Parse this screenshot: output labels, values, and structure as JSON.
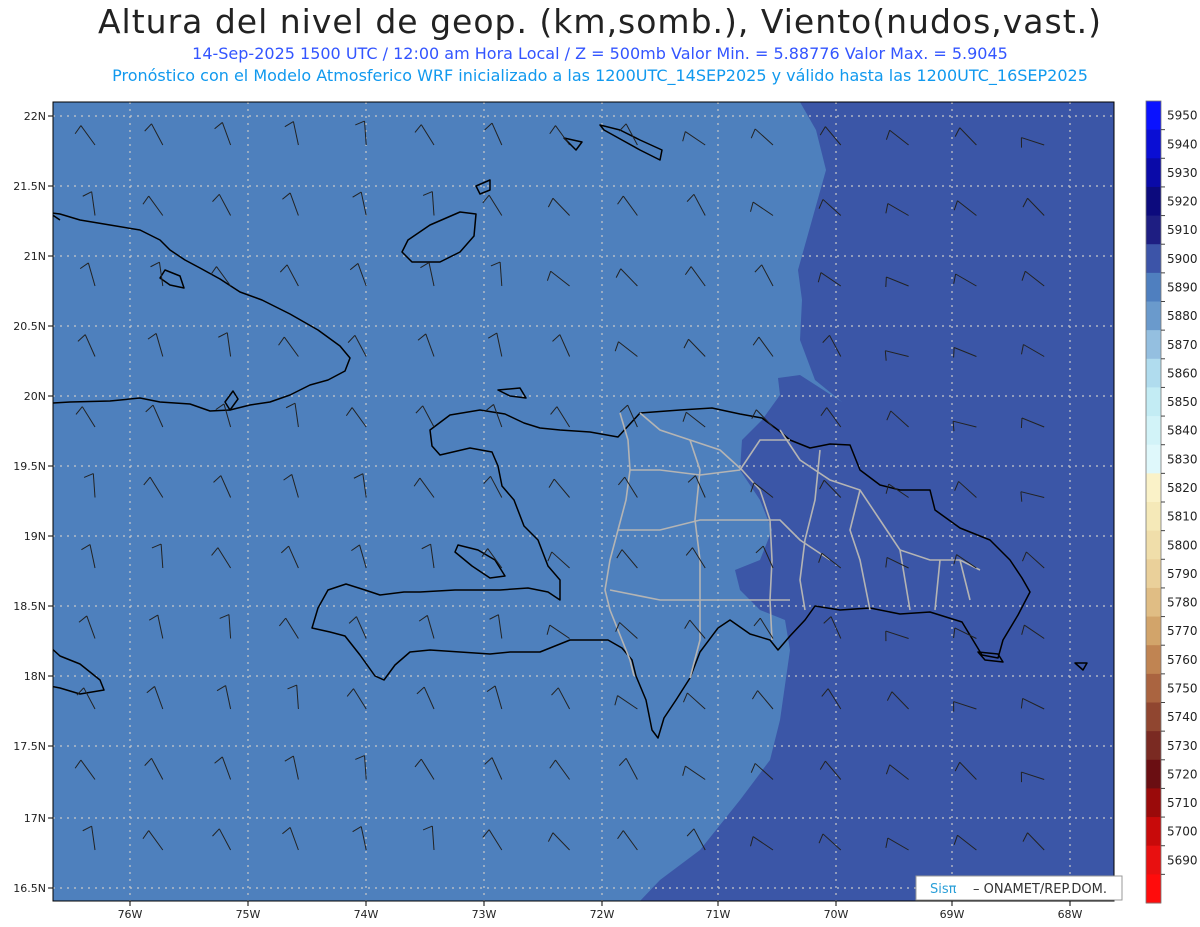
{
  "header": {
    "title": "Altura del nivel de geop. (km,somb.), Viento(nudos,vast.)",
    "line1": "14-Sep-2025  1500 UTC / 12:00 am Hora Local / Z = 500mb     Valor Min. = 5.88776  Valor Max. = 5.9045",
    "line2": "Pronóstico con el Modelo Atmosferico WRF inicializado a las 1200UTC_14SEP2025 y válido hasta las  1200UTC_16SEP2025"
  },
  "axes": {
    "lat_labels": [
      "22N",
      "21.5N",
      "21N",
      "20.5N",
      "20N",
      "19.5N",
      "19N",
      "18.5N",
      "18N",
      "17.5N",
      "17N",
      "16.5N"
    ],
    "lon_labels": [
      "76W",
      "75W",
      "74W",
      "73W",
      "72W",
      "71W",
      "70W",
      "69W",
      "68W"
    ]
  },
  "colorbar": {
    "levels": [
      "5950",
      "5940",
      "5930",
      "5920",
      "5910",
      "5900",
      "5890",
      "5880",
      "5870",
      "5860",
      "5850",
      "5840",
      "5830",
      "5820",
      "5810",
      "5800",
      "5790",
      "5780",
      "5770",
      "5760",
      "5750",
      "5740",
      "5730",
      "5720",
      "5710",
      "5700",
      "5690"
    ],
    "colors": [
      "#0a12ff",
      "#0a0ed4",
      "#0a0aa8",
      "#0c0a7d",
      "#1e1e82",
      "#3c54a8",
      "#4f7fbf",
      "#6a9acc",
      "#94bfe0",
      "#b0dcee",
      "#c3ecf4",
      "#d2f3f8",
      "#dff8fb",
      "#faf2c8",
      "#f5e9b8",
      "#f0deaa",
      "#ead09a",
      "#e0bd84",
      "#d2a46a",
      "#c08452",
      "#aa6440",
      "#904630",
      "#7a2a22",
      "#6a0e12",
      "#9a0a0a",
      "#c80a0a",
      "#e81010",
      "#ff0c0c"
    ]
  },
  "map": {
    "field_colors": {
      "west": "#4e80bd",
      "east": "#3b56a7"
    },
    "wind_barb_color": "#222222",
    "coast_color": "#000000",
    "province_color": "#b4b4b4"
  },
  "credit": {
    "brand": "Sisπ",
    "text": "– ONAMET/REP.DOM."
  }
}
